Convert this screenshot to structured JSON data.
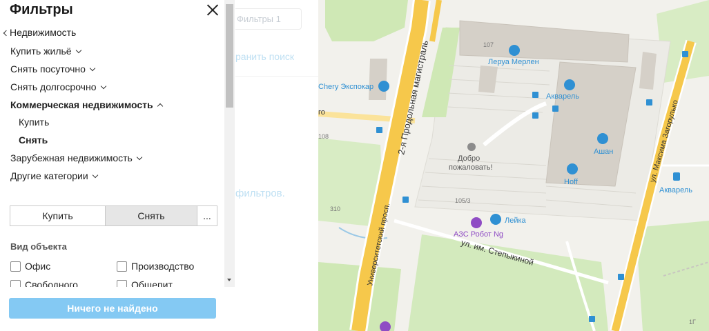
{
  "panel": {
    "title": "Фильтры",
    "back_label": "Недвижимость",
    "categories": [
      {
        "label": "Купить жильё"
      },
      {
        "label": "Снять посуточно"
      },
      {
        "label": "Снять долгосрочно"
      },
      {
        "label": "Коммерческая недвижимость"
      },
      {
        "label": "Купить"
      },
      {
        "label": "Снять"
      },
      {
        "label": "Зарубежная недвижимость"
      },
      {
        "label": "Другие категории"
      }
    ],
    "segments": {
      "buy": "Купить",
      "rent": "Снять",
      "more": "..."
    },
    "object_type": {
      "heading": "Вид объекта",
      "options": [
        "Офис",
        "Производство",
        "Свободного",
        "Общепит"
      ]
    },
    "result_button": "Ничего не найдено"
  },
  "middle": {
    "filters_label": "Фильтры 1",
    "save_search": "ранить поиск",
    "hint": "фильтров."
  },
  "map": {
    "roads": {
      "road1": "2-я Продольная магистраль",
      "road2": "Университетский просп.",
      "road3": "ул. им. Степыкиной",
      "road4": "ул. Максима Загорулько",
      "road5": "го"
    },
    "numbers": {
      "n107": "107",
      "n108": "108",
      "n310": "310",
      "n1053": "105/3",
      "n1g": "1Г"
    },
    "pois": {
      "leroy": "Леруа Мерлен",
      "akvarel": "Акварель",
      "auchan": "Ашан",
      "hoff": "Hoff",
      "chery": "Chery Экспокар",
      "welcome1": "Добро",
      "welcome2": "пожаловать!",
      "leika": "Лейка",
      "azs": "АЗС Робот Ng",
      "akvarel_stop": "Акварель"
    },
    "colors": {
      "road": "#f6c84b",
      "green": "#cfe8b5",
      "building": "#d5d0c8",
      "poi": "#2f90d3"
    }
  }
}
